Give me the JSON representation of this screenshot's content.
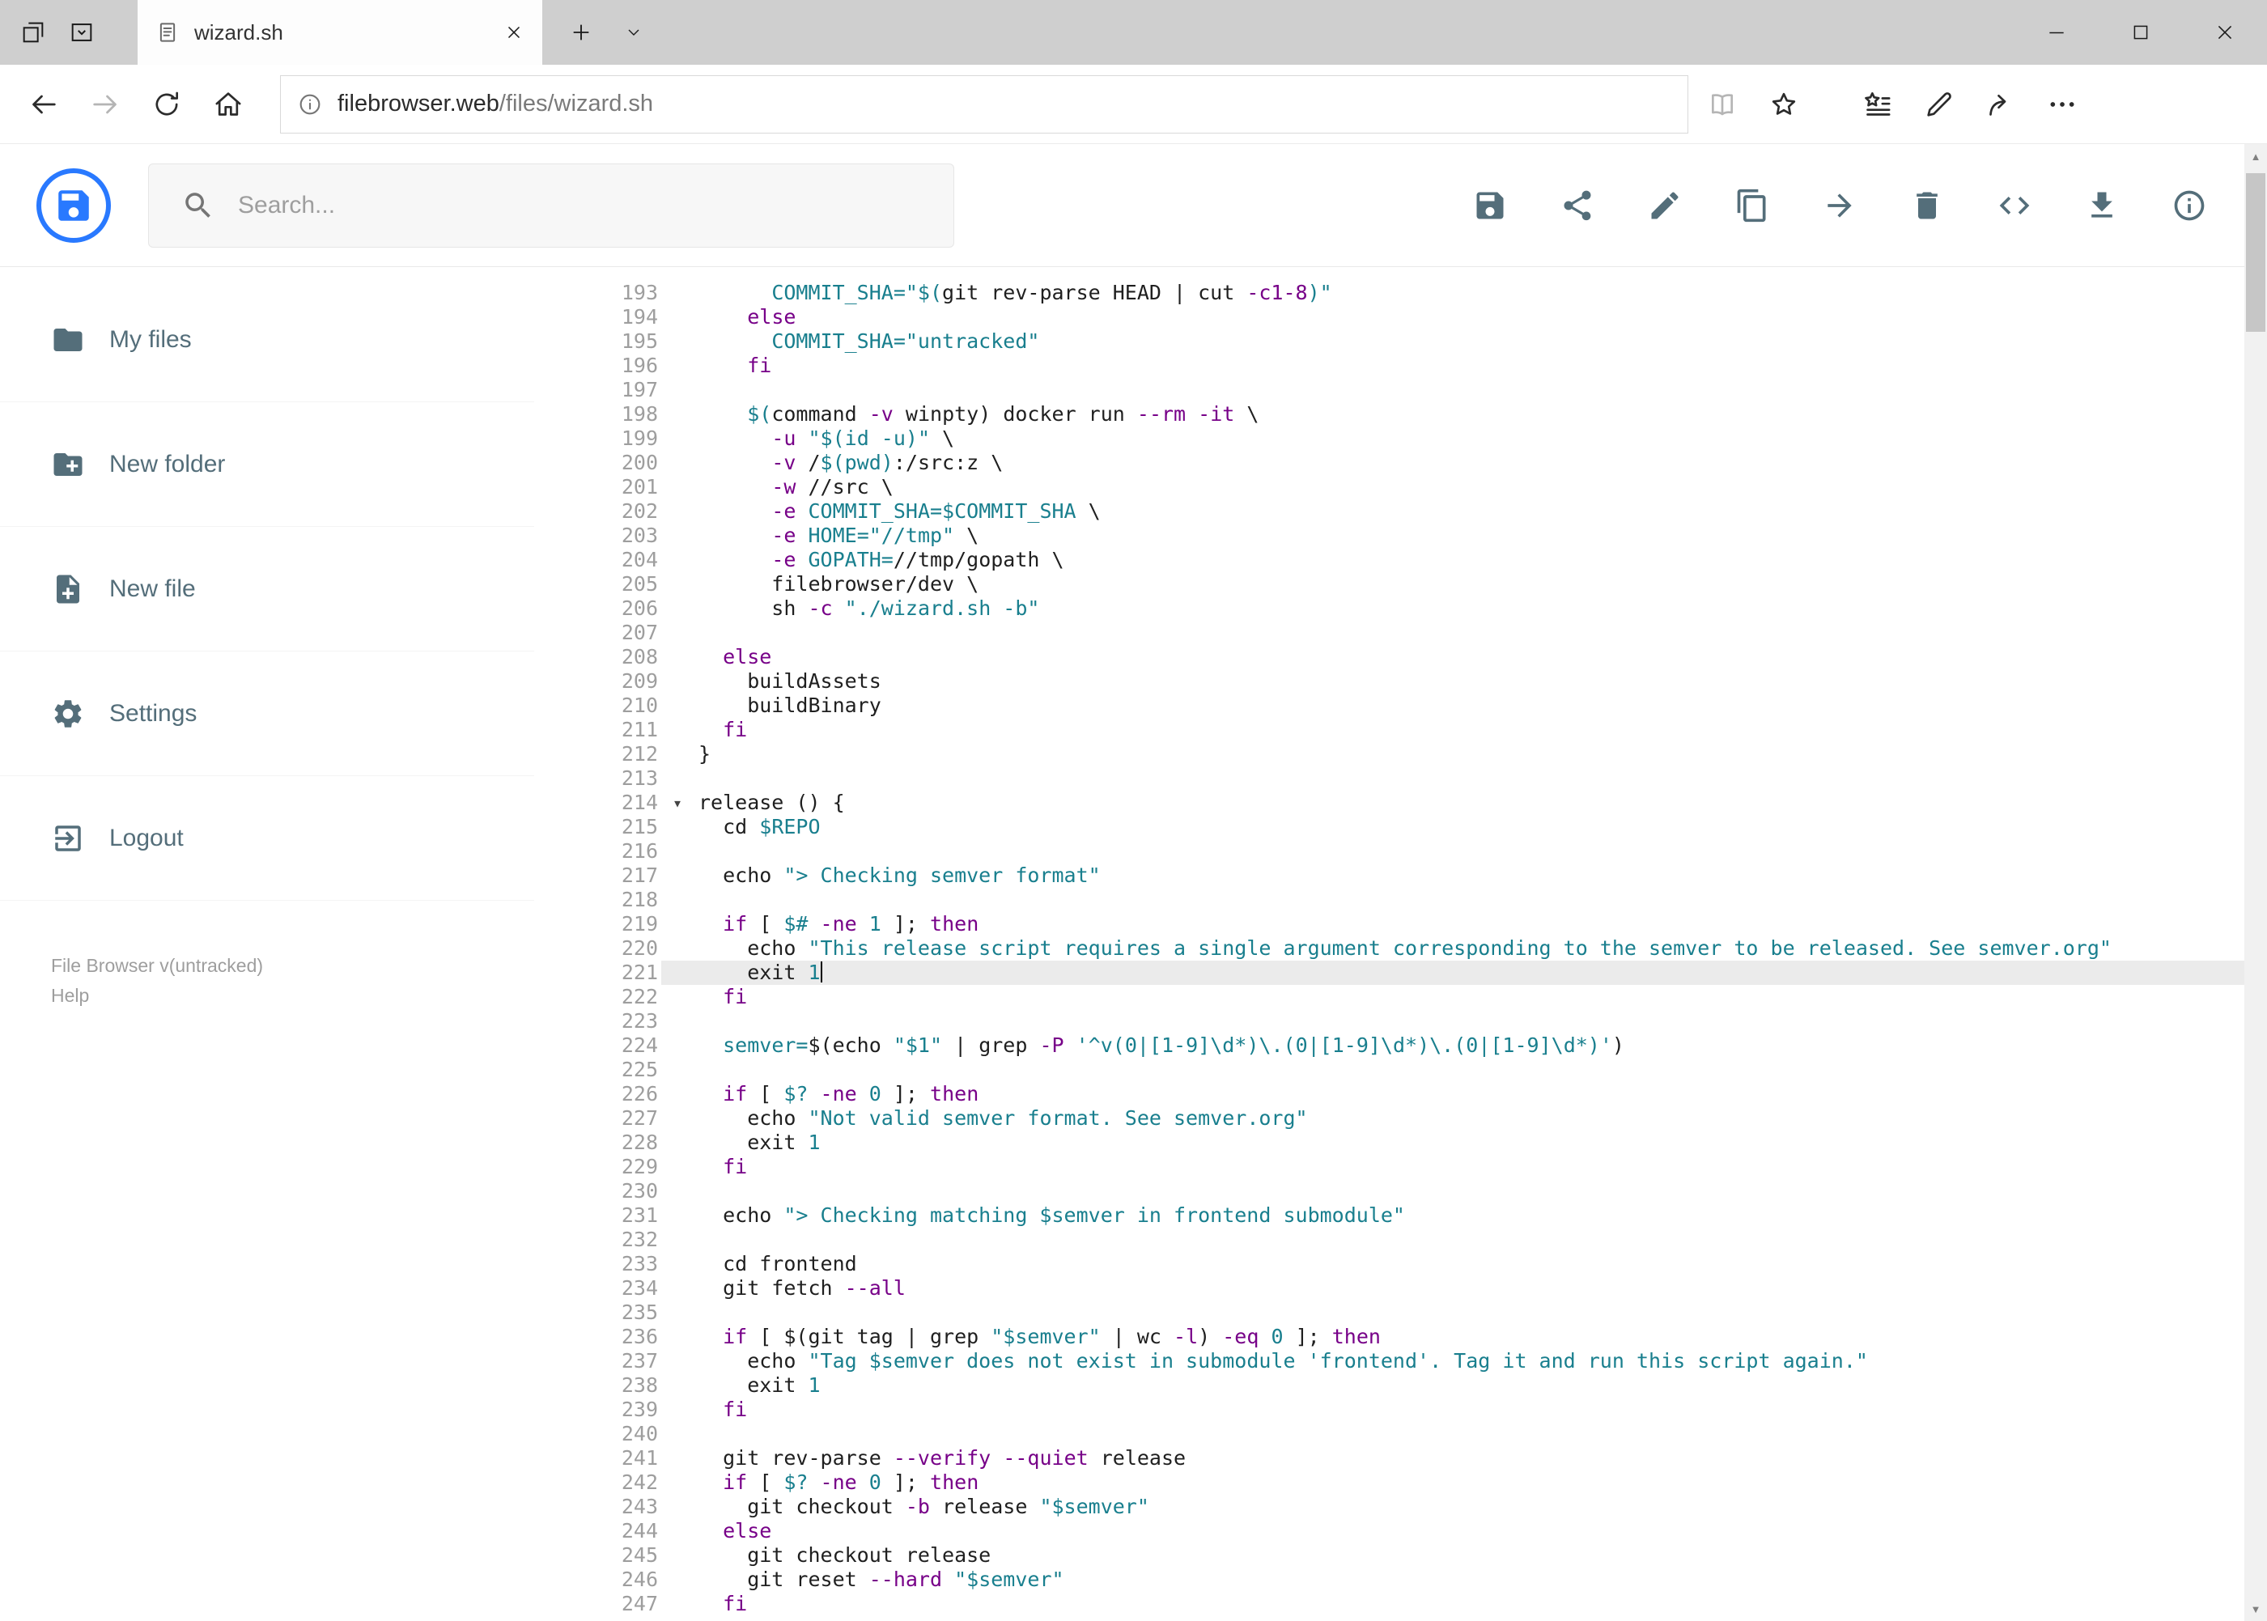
{
  "colors": {
    "accent": "#2979ff",
    "keyword": "#770088",
    "string": "#197f8e",
    "plain": "#1f1f1f",
    "active_line_bg": "#ebebeb",
    "line_number": "#9e9e9e",
    "sidebar_text": "#546e7a"
  },
  "browser": {
    "tab_title": "wizard.sh",
    "url_domain": "filebrowser.web",
    "url_path": "/files/wizard.sh",
    "chrome_icons": [
      "tabs-aside-icon",
      "tab-preview-icon",
      "page-icon",
      "tab-close-icon",
      "new-tab-icon",
      "tab-list-chevron-icon",
      "minimize-icon",
      "maximize-icon",
      "close-icon",
      "back-icon",
      "forward-icon",
      "refresh-icon",
      "home-icon",
      "site-info-icon",
      "reading-view-icon",
      "favorite-star-icon",
      "hub-icon",
      "web-note-pen-icon",
      "share-arrow-icon",
      "more-ellipsis-icon"
    ]
  },
  "header": {
    "search_placeholder": "Search...",
    "toolbar_icons": [
      "save-icon",
      "share-icon",
      "edit-icon",
      "copy-icon",
      "move-icon",
      "delete-icon",
      "code-icon",
      "download-icon",
      "info-icon"
    ]
  },
  "sidebar": {
    "items": [
      {
        "label": "My files",
        "icon": "folder-icon"
      },
      {
        "label": "New folder",
        "icon": "new-folder-icon"
      },
      {
        "label": "New file",
        "icon": "new-file-icon"
      },
      {
        "label": "Settings",
        "icon": "settings-gear-icon"
      },
      {
        "label": "Logout",
        "icon": "logout-icon"
      }
    ],
    "footer": {
      "version": "File Browser v(untracked)",
      "help": "Help"
    }
  },
  "editor": {
    "active_line": 221,
    "fold_line": 214,
    "first_line": 193,
    "last_line": 247,
    "lines": [
      {
        "n": 193,
        "s": [
          [
            "t",
            "      "
          ],
          [
            "s",
            "COMMIT_SHA=\"$("
          ],
          [
            "t",
            "git rev-parse HEAD | cut "
          ],
          [
            "k",
            "-c1-8"
          ],
          [
            "s",
            ")\""
          ]
        ]
      },
      {
        "n": 194,
        "s": [
          [
            "t",
            "    "
          ],
          [
            "k",
            "else"
          ]
        ]
      },
      {
        "n": 195,
        "s": [
          [
            "t",
            "      "
          ],
          [
            "s",
            "COMMIT_SHA=\"untracked\""
          ]
        ]
      },
      {
        "n": 196,
        "s": [
          [
            "t",
            "    "
          ],
          [
            "k",
            "fi"
          ]
        ]
      },
      {
        "n": 197,
        "s": []
      },
      {
        "n": 198,
        "s": [
          [
            "t",
            "    "
          ],
          [
            "s",
            "$("
          ],
          [
            "t",
            "command "
          ],
          [
            "k",
            "-v"
          ],
          [
            "t",
            " winpty) docker run "
          ],
          [
            "k",
            "--rm"
          ],
          [
            "t",
            " "
          ],
          [
            "k",
            "-it"
          ],
          [
            "t",
            " \\"
          ]
        ]
      },
      {
        "n": 199,
        "s": [
          [
            "t",
            "      "
          ],
          [
            "k",
            "-u"
          ],
          [
            "t",
            " "
          ],
          [
            "s",
            "\"$(id -u)\""
          ],
          [
            "t",
            " \\"
          ]
        ]
      },
      {
        "n": 200,
        "s": [
          [
            "t",
            "      "
          ],
          [
            "k",
            "-v"
          ],
          [
            "t",
            " /"
          ],
          [
            "s",
            "$(pwd)"
          ],
          [
            "t",
            ":/src:z \\"
          ]
        ]
      },
      {
        "n": 201,
        "s": [
          [
            "t",
            "      "
          ],
          [
            "k",
            "-w"
          ],
          [
            "t",
            " //src \\"
          ]
        ]
      },
      {
        "n": 202,
        "s": [
          [
            "t",
            "      "
          ],
          [
            "k",
            "-e"
          ],
          [
            "t",
            " "
          ],
          [
            "s",
            "COMMIT_SHA=$COMMIT_SHA"
          ],
          [
            "t",
            " \\"
          ]
        ]
      },
      {
        "n": 203,
        "s": [
          [
            "t",
            "      "
          ],
          [
            "k",
            "-e"
          ],
          [
            "t",
            " "
          ],
          [
            "s",
            "HOME=\"//tmp\""
          ],
          [
            "t",
            " \\"
          ]
        ]
      },
      {
        "n": 204,
        "s": [
          [
            "t",
            "      "
          ],
          [
            "k",
            "-e"
          ],
          [
            "t",
            " "
          ],
          [
            "s",
            "GOPATH="
          ],
          [
            "t",
            "//tmp/gopath \\"
          ]
        ]
      },
      {
        "n": 205,
        "s": [
          [
            "t",
            "      filebrowser/dev \\"
          ]
        ]
      },
      {
        "n": 206,
        "s": [
          [
            "t",
            "      sh "
          ],
          [
            "k",
            "-c"
          ],
          [
            "t",
            " "
          ],
          [
            "s",
            "\"./wizard.sh -b\""
          ]
        ]
      },
      {
        "n": 207,
        "s": []
      },
      {
        "n": 208,
        "s": [
          [
            "t",
            "  "
          ],
          [
            "k",
            "else"
          ]
        ]
      },
      {
        "n": 209,
        "s": [
          [
            "t",
            "    buildAssets"
          ]
        ]
      },
      {
        "n": 210,
        "s": [
          [
            "t",
            "    buildBinary"
          ]
        ]
      },
      {
        "n": 211,
        "s": [
          [
            "t",
            "  "
          ],
          [
            "k",
            "fi"
          ]
        ]
      },
      {
        "n": 212,
        "s": [
          [
            "t",
            "}"
          ]
        ]
      },
      {
        "n": 213,
        "s": []
      },
      {
        "n": 214,
        "s": [
          [
            "t",
            "release () {"
          ]
        ]
      },
      {
        "n": 215,
        "s": [
          [
            "t",
            "  cd "
          ],
          [
            "s",
            "$REPO"
          ]
        ]
      },
      {
        "n": 216,
        "s": []
      },
      {
        "n": 217,
        "s": [
          [
            "t",
            "  echo "
          ],
          [
            "s",
            "\"> Checking semver format\""
          ]
        ]
      },
      {
        "n": 218,
        "s": []
      },
      {
        "n": 219,
        "s": [
          [
            "t",
            "  "
          ],
          [
            "k",
            "if"
          ],
          [
            "t",
            " [ "
          ],
          [
            "s",
            "$#"
          ],
          [
            "t",
            " "
          ],
          [
            "k",
            "-ne"
          ],
          [
            "t",
            " "
          ],
          [
            "s",
            "1"
          ],
          [
            "t",
            " ]; "
          ],
          [
            "k",
            "then"
          ]
        ]
      },
      {
        "n": 220,
        "s": [
          [
            "t",
            "    echo "
          ],
          [
            "s",
            "\"This release script requires a single argument corresponding to the semver to be released. See semver.org\""
          ]
        ]
      },
      {
        "n": 221,
        "s": [
          [
            "t",
            "    exit "
          ],
          [
            "s",
            "1"
          ]
        ]
      },
      {
        "n": 222,
        "s": [
          [
            "t",
            "  "
          ],
          [
            "k",
            "fi"
          ]
        ]
      },
      {
        "n": 223,
        "s": []
      },
      {
        "n": 224,
        "s": [
          [
            "t",
            "  "
          ],
          [
            "s",
            "semver="
          ],
          [
            "t",
            "$(echo "
          ],
          [
            "s",
            "\"$1\""
          ],
          [
            "t",
            " | grep "
          ],
          [
            "k",
            "-P"
          ],
          [
            "t",
            " "
          ],
          [
            "s",
            "'^v(0|[1-9]\\d*)\\.(0|[1-9]\\d*)\\.(0|[1-9]\\d*)'"
          ],
          [
            "t",
            ")"
          ]
        ]
      },
      {
        "n": 225,
        "s": []
      },
      {
        "n": 226,
        "s": [
          [
            "t",
            "  "
          ],
          [
            "k",
            "if"
          ],
          [
            "t",
            " [ "
          ],
          [
            "s",
            "$?"
          ],
          [
            "t",
            " "
          ],
          [
            "k",
            "-ne"
          ],
          [
            "t",
            " "
          ],
          [
            "s",
            "0"
          ],
          [
            "t",
            " ]; "
          ],
          [
            "k",
            "then"
          ]
        ]
      },
      {
        "n": 227,
        "s": [
          [
            "t",
            "    echo "
          ],
          [
            "s",
            "\"Not valid semver format. See semver.org\""
          ]
        ]
      },
      {
        "n": 228,
        "s": [
          [
            "t",
            "    exit "
          ],
          [
            "s",
            "1"
          ]
        ]
      },
      {
        "n": 229,
        "s": [
          [
            "t",
            "  "
          ],
          [
            "k",
            "fi"
          ]
        ]
      },
      {
        "n": 230,
        "s": []
      },
      {
        "n": 231,
        "s": [
          [
            "t",
            "  echo "
          ],
          [
            "s",
            "\"> Checking matching $semver in frontend submodule\""
          ]
        ]
      },
      {
        "n": 232,
        "s": []
      },
      {
        "n": 233,
        "s": [
          [
            "t",
            "  cd frontend"
          ]
        ]
      },
      {
        "n": 234,
        "s": [
          [
            "t",
            "  git fetch "
          ],
          [
            "k",
            "--all"
          ]
        ]
      },
      {
        "n": 235,
        "s": []
      },
      {
        "n": 236,
        "s": [
          [
            "t",
            "  "
          ],
          [
            "k",
            "if"
          ],
          [
            "t",
            " [ $(git tag | grep "
          ],
          [
            "s",
            "\"$semver\""
          ],
          [
            "t",
            " | wc "
          ],
          [
            "k",
            "-l"
          ],
          [
            "t",
            ") "
          ],
          [
            "k",
            "-eq"
          ],
          [
            "t",
            " "
          ],
          [
            "s",
            "0"
          ],
          [
            "t",
            " ]; "
          ],
          [
            "k",
            "then"
          ]
        ]
      },
      {
        "n": 237,
        "s": [
          [
            "t",
            "    echo "
          ],
          [
            "s",
            "\"Tag $semver does not exist in submodule 'frontend'. Tag it and run this script again.\""
          ]
        ]
      },
      {
        "n": 238,
        "s": [
          [
            "t",
            "    exit "
          ],
          [
            "s",
            "1"
          ]
        ]
      },
      {
        "n": 239,
        "s": [
          [
            "t",
            "  "
          ],
          [
            "k",
            "fi"
          ]
        ]
      },
      {
        "n": 240,
        "s": []
      },
      {
        "n": 241,
        "s": [
          [
            "t",
            "  git rev-parse "
          ],
          [
            "k",
            "--verify"
          ],
          [
            "t",
            " "
          ],
          [
            "k",
            "--quiet"
          ],
          [
            "t",
            " release"
          ]
        ]
      },
      {
        "n": 242,
        "s": [
          [
            "t",
            "  "
          ],
          [
            "k",
            "if"
          ],
          [
            "t",
            " [ "
          ],
          [
            "s",
            "$?"
          ],
          [
            "t",
            " "
          ],
          [
            "k",
            "-ne"
          ],
          [
            "t",
            " "
          ],
          [
            "s",
            "0"
          ],
          [
            "t",
            " ]; "
          ],
          [
            "k",
            "then"
          ]
        ]
      },
      {
        "n": 243,
        "s": [
          [
            "t",
            "    git checkout "
          ],
          [
            "k",
            "-b"
          ],
          [
            "t",
            " release "
          ],
          [
            "s",
            "\"$semver\""
          ]
        ]
      },
      {
        "n": 244,
        "s": [
          [
            "t",
            "  "
          ],
          [
            "k",
            "else"
          ]
        ]
      },
      {
        "n": 245,
        "s": [
          [
            "t",
            "    git checkout release"
          ]
        ]
      },
      {
        "n": 246,
        "s": [
          [
            "t",
            "    git reset "
          ],
          [
            "k",
            "--hard"
          ],
          [
            "t",
            " "
          ],
          [
            "s",
            "\"$semver\""
          ]
        ]
      },
      {
        "n": 247,
        "s": [
          [
            "t",
            "  "
          ],
          [
            "k",
            "fi"
          ]
        ]
      }
    ]
  }
}
